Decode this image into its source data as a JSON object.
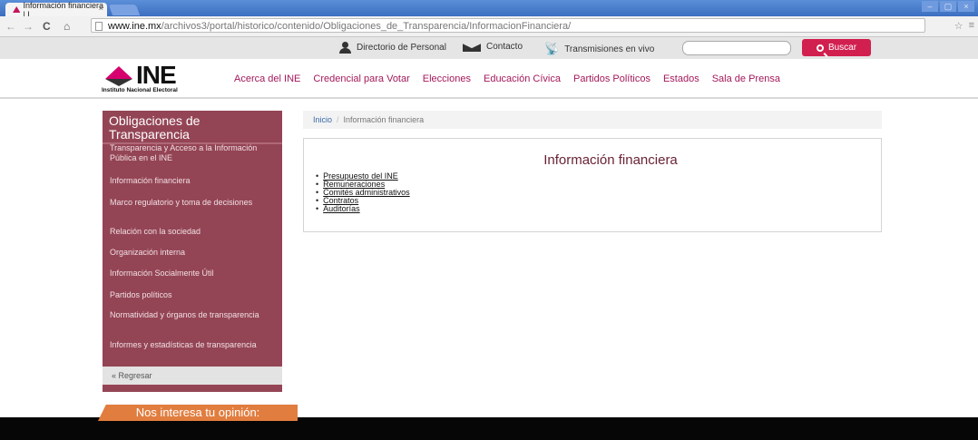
{
  "browser": {
    "tab_title": "Información financiera | I",
    "tab_close": "×",
    "nav_back": "←",
    "nav_forward": "→",
    "nav_reload": "C",
    "nav_home": "⌂",
    "url_host": "www.ine.mx",
    "url_path": "/archivos3/portal/historico/contenido/Obligaciones_de_Transparencia/InformacionFinanciera/",
    "win_min": "‒",
    "win_max": "▢",
    "win_close": "×",
    "star": "☆",
    "menu": "≡"
  },
  "utility": {
    "directorio": "Directorio de Personal",
    "contacto": "Contacto",
    "transmisiones": "Transmisiones en vivo",
    "search_placeholder": "",
    "search_button": "Buscar"
  },
  "header": {
    "logo_word": "INE",
    "logo_sub": "Instituto Nacional Electoral",
    "nav": [
      "Acerca del INE",
      "Credencial para Votar",
      "Elecciones",
      "Educación Cívica",
      "Partidos Políticos",
      "Estados",
      "Sala de Prensa"
    ]
  },
  "sidebar": {
    "title": "Obligaciones de Transparencia",
    "items": [
      "Transparencia y Acceso a la Información Pública en el INE",
      "Información financiera",
      "Marco regulatorio y toma de decisiones",
      "Relación con la sociedad",
      "Organización interna",
      "Información Socialmente Útil",
      "Partidos políticos",
      "Normatividad y órganos de transparencia",
      "Informes y estadísticas de transparencia"
    ],
    "back": "« Regresar"
  },
  "breadcrumb": {
    "home": "Inicio",
    "sep": "/",
    "current": "Información financiera"
  },
  "content": {
    "title": "Información financiera",
    "links": [
      "Presupuesto del INE",
      "Remuneraciones",
      "Comités administrativos",
      "Contratos",
      "Auditorías"
    ]
  },
  "opinion": "Nos interesa tu opinión:",
  "colors": {
    "brand_magenta": "#d6006f",
    "sidebar": "#944555",
    "search_button": "#d1204f",
    "opinion": "#e17d3f"
  }
}
